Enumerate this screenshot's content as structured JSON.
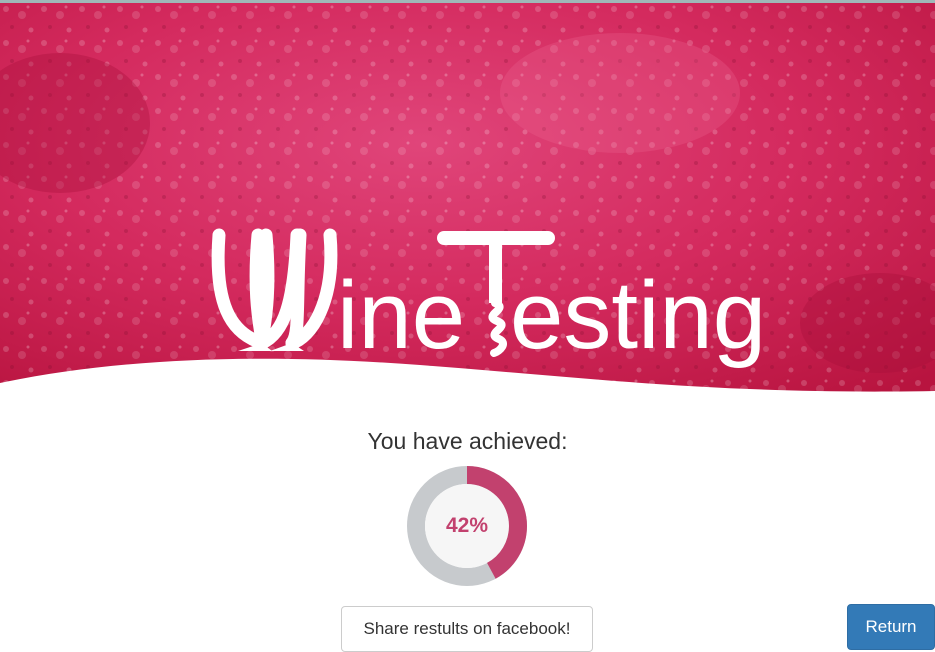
{
  "brand": {
    "logo_text_part1": "ine",
    "logo_text_part2": "esting",
    "logo_alt": "WineTesting"
  },
  "colors": {
    "hero_base": "#d41f58",
    "accent": "#c2416e",
    "gauge_track": "#c7cacd",
    "button_primary": "#337ab7"
  },
  "result": {
    "heading": "You have achieved:",
    "percent_label": "42%",
    "percent_value": 42
  },
  "actions": {
    "share_label": "Share restults on facebook!",
    "return_label": "Return"
  }
}
